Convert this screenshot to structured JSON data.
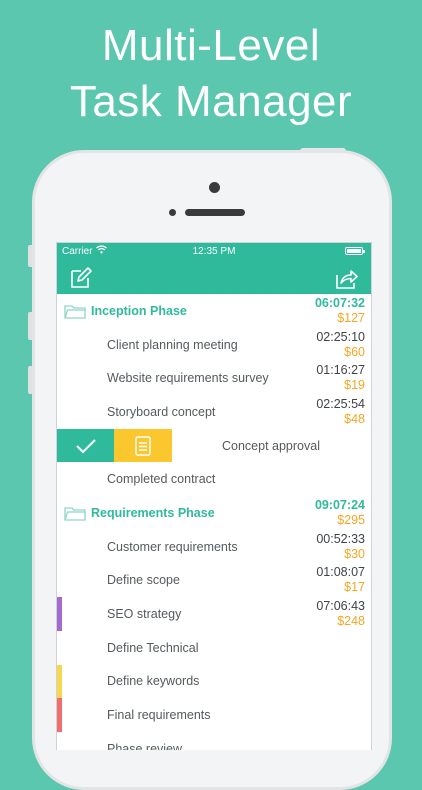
{
  "headline": {
    "line1": "Multi-Level",
    "line2": "Task Manager"
  },
  "status_bar": {
    "carrier": "Carrier",
    "time": "12:35 PM"
  },
  "colors": {
    "background": "#5bc7ae",
    "accent": "#2fba9c",
    "cost": "#f6a623",
    "note_action": "#fbc72e"
  },
  "rows": [
    {
      "kind": "phase",
      "label": "Inception Phase",
      "duration": "06:07:32",
      "cost": "$127"
    },
    {
      "kind": "task",
      "label": "Client planning meeting",
      "duration": "02:25:10",
      "cost": "$60"
    },
    {
      "kind": "task",
      "label": "Website requirements survey",
      "duration": "01:16:27",
      "cost": "$19"
    },
    {
      "kind": "task",
      "label": "Storyboard concept",
      "duration": "02:25:54",
      "cost": "$48"
    },
    {
      "kind": "swiped",
      "label": "Concept approval"
    },
    {
      "kind": "task",
      "label": "Completed contract"
    },
    {
      "kind": "phase",
      "label": "Requirements Phase",
      "duration": "09:07:24",
      "cost": "$295"
    },
    {
      "kind": "task",
      "label": "Customer requirements",
      "duration": "00:52:33",
      "cost": "$30"
    },
    {
      "kind": "task",
      "label": "Define scope",
      "duration": "01:08:07",
      "cost": "$17"
    },
    {
      "kind": "task",
      "label": "SEO strategy",
      "duration": "07:06:43",
      "cost": "$248",
      "tag": "#a56ad0"
    },
    {
      "kind": "task",
      "label": "Define Technical"
    },
    {
      "kind": "task",
      "label": "Define keywords",
      "tag": "#f7d84a"
    },
    {
      "kind": "task",
      "label": "Final requirements",
      "tag": "#ef6f6f"
    },
    {
      "kind": "task",
      "label": "Phase review"
    }
  ]
}
